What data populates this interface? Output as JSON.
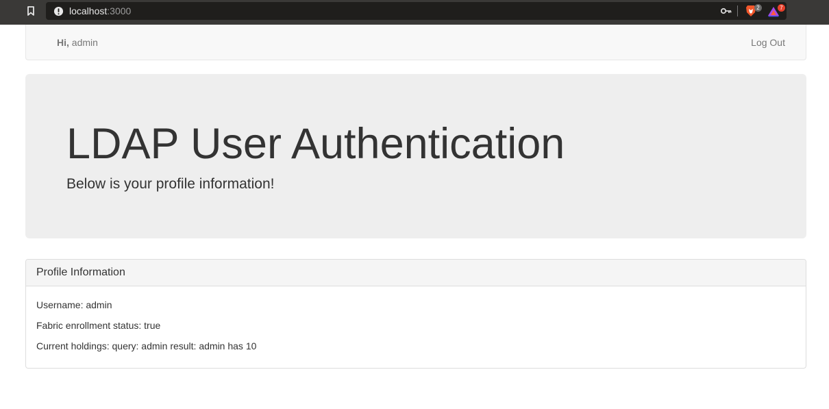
{
  "browser": {
    "url_host": "localhost",
    "url_port": ":3000",
    "extensions": {
      "brave_shields_badge": "2",
      "rewards_badge": "7"
    }
  },
  "navbar": {
    "greeting_prefix": "Hi,",
    "username": "admin",
    "logout_label": "Log Out"
  },
  "jumbotron": {
    "title": "LDAP User Authentication",
    "lead": "Below is your profile information!"
  },
  "profile_panel": {
    "title": "Profile Information",
    "rows": [
      "Username: admin",
      "Fabric enrollment status: true",
      "Current holdings: query: admin result: admin has 10"
    ]
  },
  "colors": {
    "chrome_bg": "#3a3937",
    "urlbar_bg": "#1f1e1c",
    "navbar_bg": "#f8f8f8",
    "jumbotron_bg": "#eeeeee",
    "panel_heading_bg": "#f5f5f5",
    "text": "#333333",
    "muted_text": "#777777"
  }
}
